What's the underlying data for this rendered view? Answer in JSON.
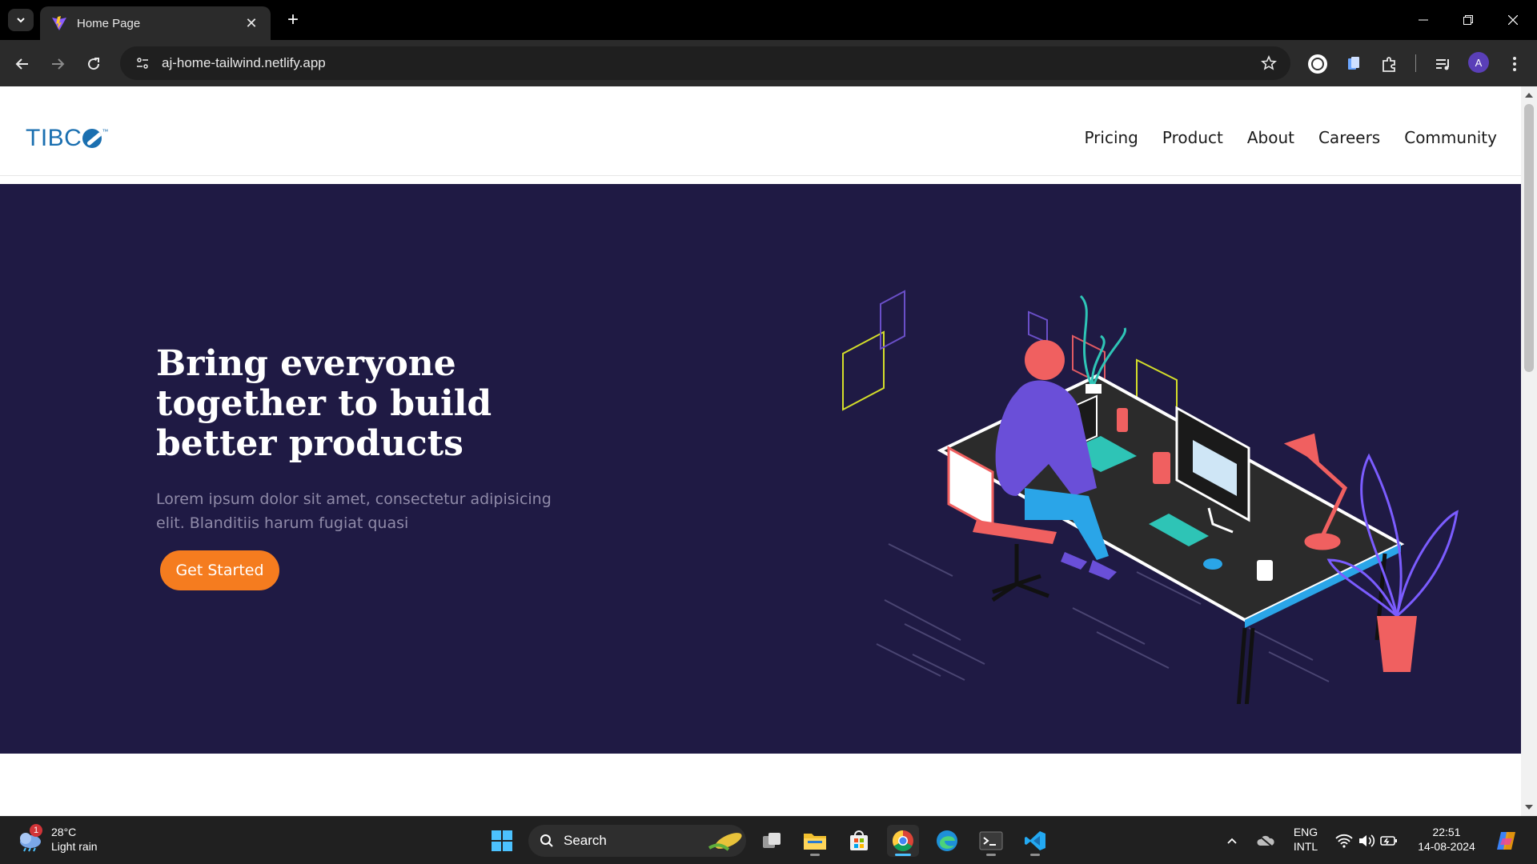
{
  "browser": {
    "tab": {
      "title": "Home Page"
    },
    "url": "aj-home-tailwind.netlify.app",
    "profile_initial": "A"
  },
  "site": {
    "logo_text": "TIBC",
    "logo_tm": "™",
    "nav": [
      "Pricing",
      "Product",
      "About",
      "Careers",
      "Community"
    ],
    "hero": {
      "title": "Bring everyone together to build better products",
      "subtitle": "Lorem ipsum dolor sit amet, consectetur adipisicing elit. Blanditiis harum fugiat quasi",
      "cta_label": "Get Started"
    },
    "colors": {
      "hero_bg": "#1f1a44",
      "cta": "#f57c1f",
      "logo": "#1a6fb0"
    }
  },
  "taskbar": {
    "weather": {
      "temp": "28°C",
      "condition": "Light rain",
      "badge": "1"
    },
    "search_label": "Search",
    "lang_top": "ENG",
    "lang_bottom": "INTL",
    "time": "22:51",
    "date": "14-08-2024"
  }
}
